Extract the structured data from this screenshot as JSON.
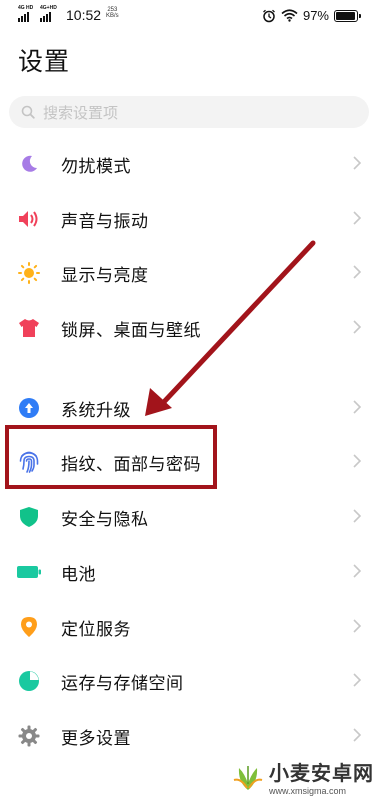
{
  "status_bar": {
    "signal1_label": "4G HD",
    "signal2_label": "4G+HD",
    "time": "10:52",
    "speed_value": "253",
    "speed_unit": "KB/s",
    "battery_text": "97%",
    "battery_level": 0.97,
    "icons": [
      "alarm-icon",
      "wifi-icon",
      "battery-icon"
    ]
  },
  "page": {
    "title": "设置"
  },
  "search": {
    "placeholder": "搜索设置项"
  },
  "items": [
    {
      "label": "勿扰模式",
      "icon": "moon-icon",
      "color": "#a77ce6"
    },
    {
      "label": "声音与振动",
      "icon": "speaker-icon",
      "color": "#f0415a"
    },
    {
      "label": "显示与亮度",
      "icon": "sun-icon",
      "color": "#ffb21a"
    },
    {
      "label": "锁屏、桌面与壁纸",
      "icon": "tshirt-icon",
      "color": "#f0415a"
    },
    {
      "label": "系统升级",
      "icon": "upgrade-arrow-icon",
      "color": "#2f7cf6"
    },
    {
      "label": "指纹、面部与密码",
      "icon": "fingerprint-icon",
      "color": "#4a73e8"
    },
    {
      "label": "安全与隐私",
      "icon": "shield-icon",
      "color": "#11c28a"
    },
    {
      "label": "电池",
      "icon": "battery-item-icon",
      "color": "#1ac9a0"
    },
    {
      "label": "定位服务",
      "icon": "location-pin-icon",
      "color": "#ff9e1a"
    },
    {
      "label": "运存与存储空间",
      "icon": "pie-chart-icon",
      "color": "#1ac9a0"
    },
    {
      "label": "更多设置",
      "icon": "gear-icon",
      "color": "#888888"
    }
  ],
  "annotation": {
    "color": "#a2141b"
  },
  "watermark": {
    "name": "小麦安卓网",
    "url": "www.xmsigma.com"
  }
}
